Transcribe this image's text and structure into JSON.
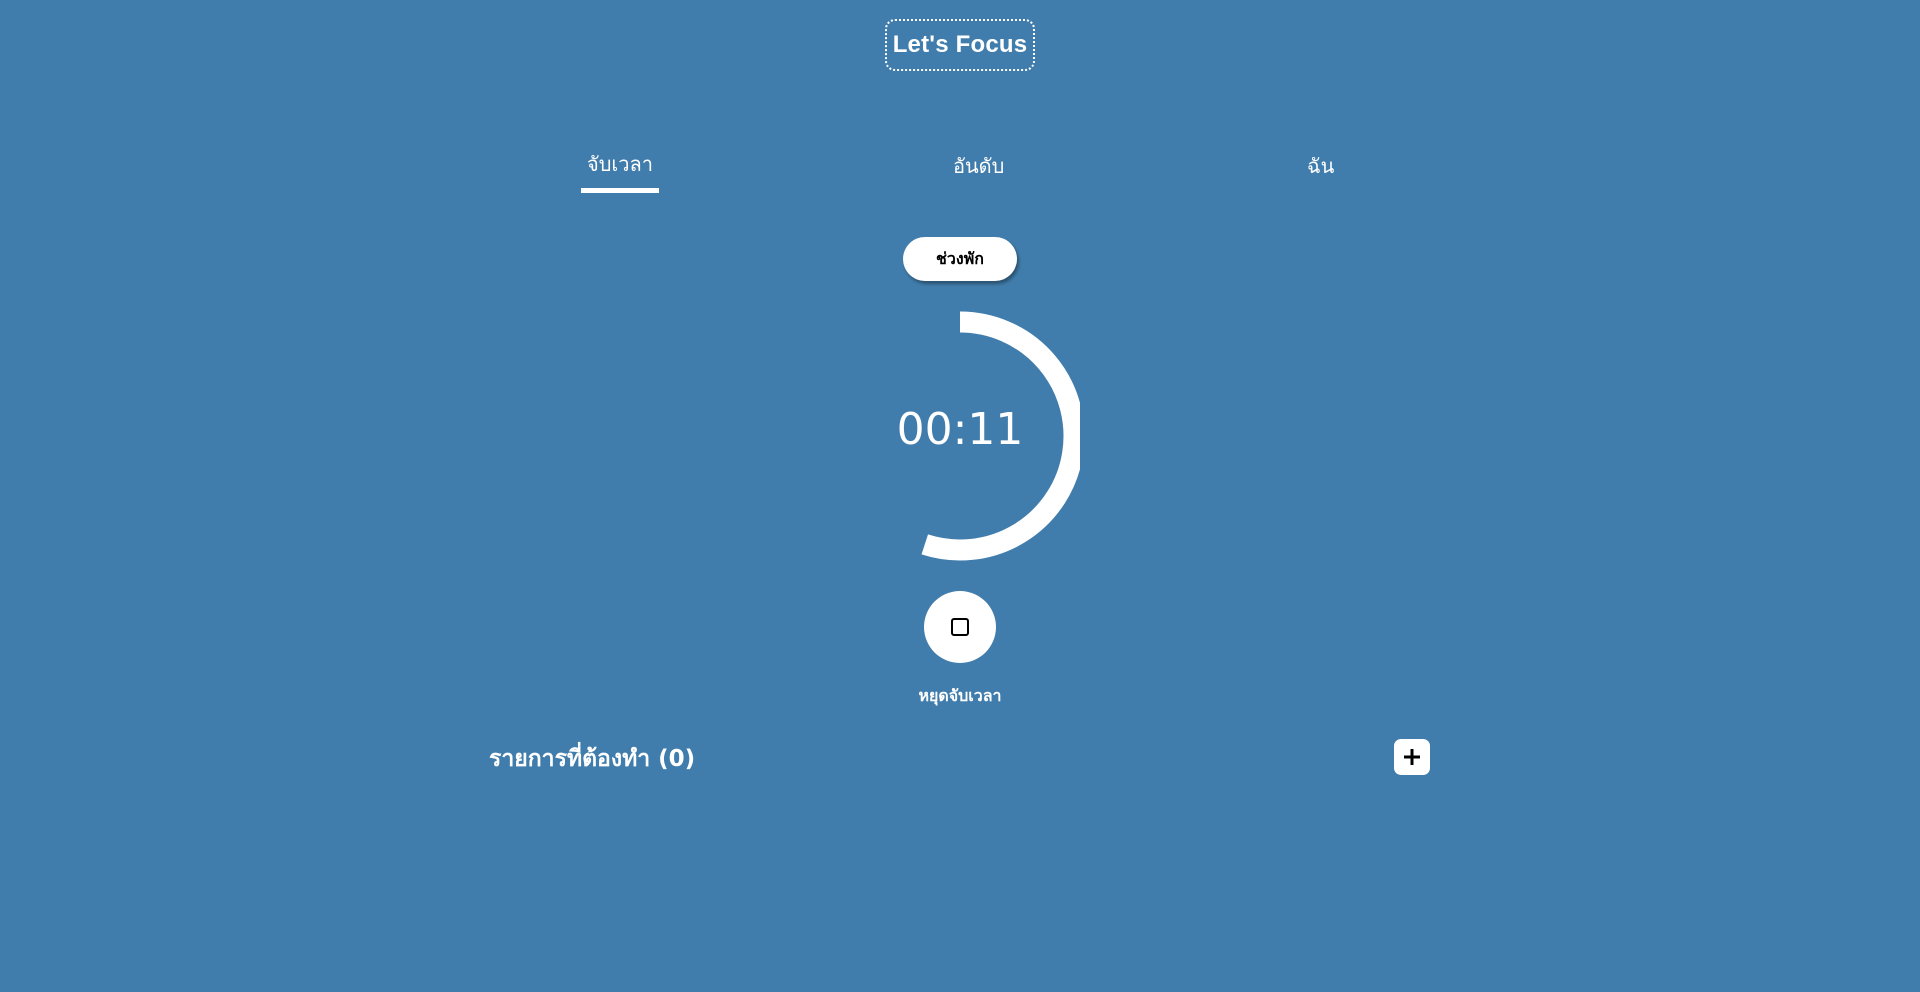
{
  "brand": {
    "logo_text": "Let's Focus"
  },
  "nav": {
    "tabs": [
      {
        "label": "จับเวลา",
        "active": true
      },
      {
        "label": "อันดับ",
        "active": false
      },
      {
        "label": "ฉัน",
        "active": false
      }
    ]
  },
  "timer": {
    "mode_label": "ช่วงพัก",
    "display": "00:11",
    "stop_label": "หยุดจับเวลา",
    "progress_fraction": 0.55
  },
  "todo": {
    "title": "รายการที่ต้องทำ (0)"
  },
  "icons": {
    "stop": "stop-icon",
    "add": "plus-icon"
  },
  "colors": {
    "background": "#417dac",
    "foreground": "#ffffff"
  }
}
